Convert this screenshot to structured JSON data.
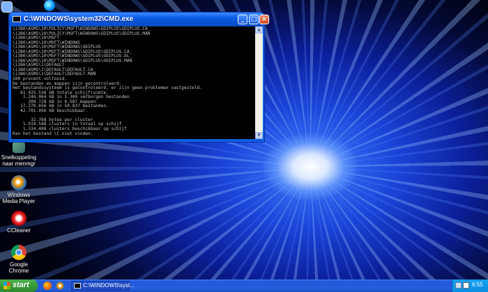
{
  "window": {
    "title": "C:\\WINDOWS\\system32\\CMD.exe",
    "lines": [
      "\\i386\\ASMS\\10\\POLICY\\MSFT\\WINDOWS\\GDIPLUS\\GDIPLUS.CA_",
      "\\i386\\ASMS\\10\\POLICY\\MSFT\\WINDOWS\\GDIPLUS\\GDIPLUS.MAN",
      "\\i386\\ASMS\\10\\MSFT",
      "\\i386\\ASMS\\10\\MSFT\\WINDOWS",
      "\\i386\\ASMS\\10\\MSFT\\WINDOWS\\GDIPLUS",
      "\\i386\\ASMS\\10\\MSFT\\WINDOWS\\GDIPLUS\\GDIPLUS.CA_",
      "\\i386\\ASMS\\10\\MSFT\\WINDOWS\\GDIPLUS\\GDIPLUS.DL_",
      "\\i386\\ASMS\\10\\MSFT\\WINDOWS\\GDIPLUS\\GDIPLUS.MAN",
      "\\i386\\ASMS\\1\\DEFAULT",
      "\\i386\\ASMS\\1\\DEFAULT\\DEFAULT.CA_",
      "\\i386\\ASMS\\1\\DEFAULT\\DEFAULT.MAN",
      "100 procent voltooid.",
      "De bestanden en mappen zijn gecontroleerd.",
      "Het bestandssysteem is gecontroleerd, er zijn geen problemen vastgesteld.",
      "   61.425.536 kB totale schijfruimte.",
      "    1.244.064 kB in 1.300 verborgen bestanden.",
      "      209.728 kB in 6.587 mappen.",
      "   17.270.656 kB in 50.837 bestanden.",
      "   42.701.056 kB beschikbaar.",
      "",
      "       32.768 bytes per cluster",
      "    1.919.548 clusters in totaal op schijf",
      "    1.334.408 clusters beschikbaar op schijf",
      "Kan het bestand \\C niet vinden.",
      "",
      "C:\\>"
    ],
    "buttons": {
      "minimize": "_",
      "maximize": "□",
      "close": "×"
    }
  },
  "desktop_icons": [
    {
      "label": "Snelkoppeling naar menmgr"
    },
    {
      "label": "Windows Media Player"
    },
    {
      "label": "CCleaner"
    },
    {
      "label": "Google Chrome"
    }
  ],
  "taskbar": {
    "start_label": "start",
    "task_label": "C:\\WINDOWS\\syst...",
    "clock": "6:55"
  },
  "colors": {
    "taskbar_blue": "#245edc",
    "start_green": "#3a9a3a",
    "console_bg": "#000000",
    "console_text": "#c0c0c0"
  }
}
